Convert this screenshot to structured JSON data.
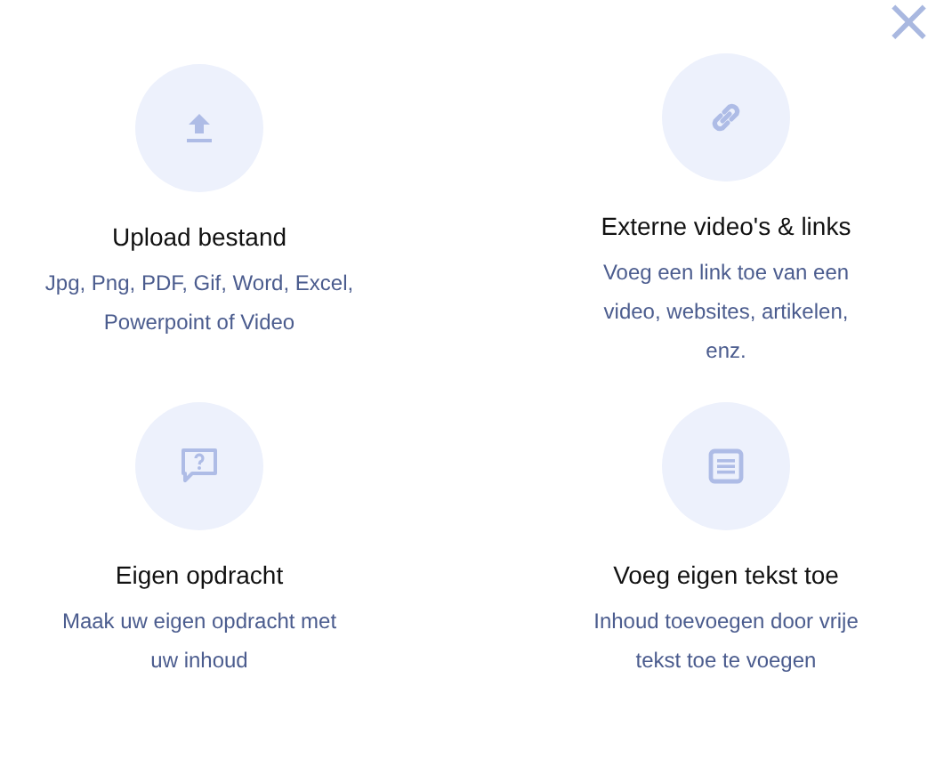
{
  "close_button": {
    "label": "×"
  },
  "options": [
    {
      "kind": "upload",
      "title": "Upload bestand",
      "description": "Jpg, Png, PDF, Gif, Word, Excel, Powerpoint of Video"
    },
    {
      "kind": "link",
      "title": "Externe video's & links",
      "description": "Voeg een link toe van een video, websites, artikelen, enz."
    },
    {
      "kind": "question",
      "title": "Eigen opdracht",
      "description": "Maak uw eigen opdracht met uw inhoud"
    },
    {
      "kind": "text",
      "title": "Voeg eigen tekst toe",
      "description": "Inhoud toevoegen door vrije tekst toe te voegen"
    }
  ]
}
